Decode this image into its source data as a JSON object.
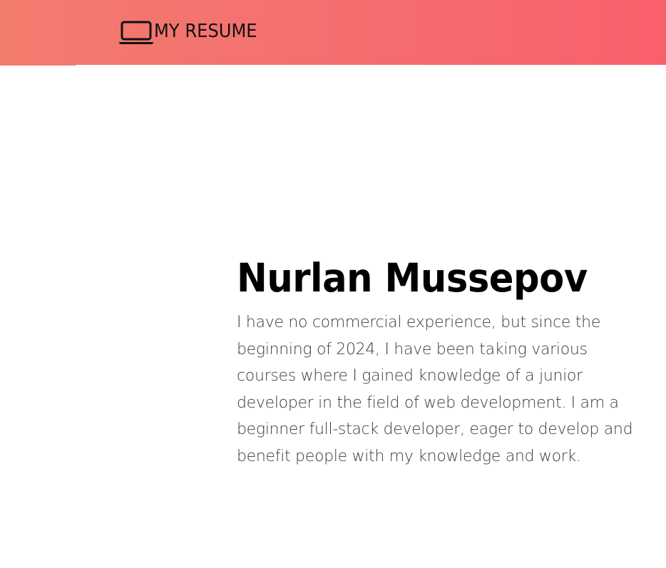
{
  "header": {
    "brand_icon": "laptop-icon",
    "brand_label": "MY RESUME",
    "gradient_start": "#f27c6e",
    "gradient_end": "#fa606c"
  },
  "hero": {
    "name": "Nurlan Mussepov",
    "bio": "I have no commercial experience, but since the beginning of 2024, I have been taking various courses where I gained knowledge of a junior developer in the field of web development. I am a beginner full-stack developer, eager to develop and benefit people with my knowledge and work."
  }
}
